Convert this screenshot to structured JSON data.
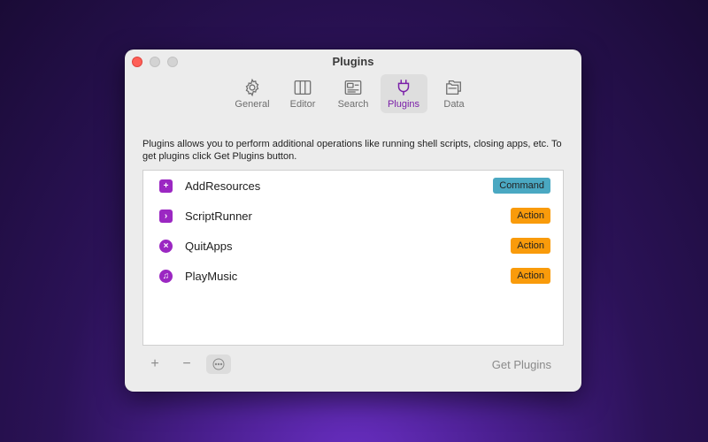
{
  "window": {
    "title": "Plugins"
  },
  "toolbar": {
    "items": [
      {
        "label": "General",
        "icon": "gear-icon"
      },
      {
        "label": "Editor",
        "icon": "columns-icon"
      },
      {
        "label": "Search",
        "icon": "search-window-icon"
      },
      {
        "label": "Plugins",
        "icon": "plug-icon",
        "active": true
      },
      {
        "label": "Data",
        "icon": "folders-icon"
      }
    ]
  },
  "description": "Plugins allows you to perform additional operations like running shell scripts, closing apps, etc. To get plugins click Get Plugins button.",
  "plugins": [
    {
      "name": "AddResources",
      "glyph": "+",
      "icon": "add-square-icon",
      "badge": "Command",
      "badge_color": "#4aa8c2"
    },
    {
      "name": "ScriptRunner",
      "glyph": "›",
      "icon": "chevron-square-icon",
      "badge": "Action",
      "badge_color": "#f99b0b"
    },
    {
      "name": "QuitApps",
      "glyph": "×",
      "icon": "x-circle-icon",
      "badge": "Action",
      "badge_color": "#f99b0b"
    },
    {
      "name": "PlayMusic",
      "glyph": "♫",
      "icon": "music-note-icon",
      "badge": "Action",
      "badge_color": "#f99b0b"
    }
  ],
  "footer": {
    "add_label": "+",
    "remove_label": "−",
    "more_label": "⋯",
    "get_plugins_label": "Get Plugins"
  },
  "colors": {
    "accent": "#7a1fa8",
    "plugin_icon": "#9b27c2",
    "close_light": "#fe5f57"
  }
}
